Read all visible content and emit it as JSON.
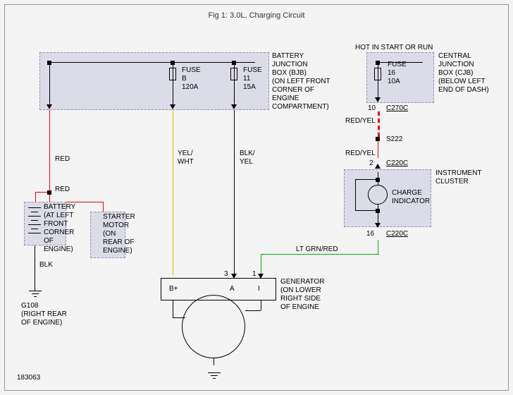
{
  "figure": {
    "title": "Fig 1: 3.0L, Charging Circuit",
    "ref_num": "183063"
  },
  "bjb": {
    "name": "BATTERY\nJUNCTION\nBOX (BJB)\n(ON LEFT FRONT\nCORNER OF\nENGINE\nCOMPARTMENT)",
    "fuse_b": {
      "label": "FUSE\nB\n120A"
    },
    "fuse_11": {
      "label": "FUSE\n11\n15A"
    }
  },
  "cjb": {
    "top_label": "HOT IN START OR RUN",
    "name": "CENTRAL\nJUNCTION\nBOX (CJB)\n(BELOW LEFT\nEND OF DASH)",
    "fuse_16": {
      "label": "FUSE\n16\n10A"
    },
    "pin10": "10",
    "c270c": "C270C"
  },
  "battery": {
    "name": "BATTERY\n(AT LEFT\nFRONT\nCORNER\nOF\nENGINE)"
  },
  "starter": {
    "name": "STARTER\nMOTOR\n(ON\nREAR OF\nENGINE)"
  },
  "instrument_cluster": {
    "name": "INSTRUMENT\nCLUSTER",
    "indicator": "CHARGE\nINDICATOR",
    "pin2": "2",
    "pin16": "16",
    "c220c_top": "C220C",
    "c220c_bot": "C220C"
  },
  "generator": {
    "name": "GENERATOR\n(ON LOWER\nRIGHT SIDE\nOF ENGINE",
    "b_plus": "B+",
    "a": "A",
    "i": "I",
    "pin3": "3",
    "pin1": "1"
  },
  "wires": {
    "red": "RED",
    "red2": "RED",
    "yel_wht": "YEL/\nWHT",
    "blk_yel": "BLK/\nYEL",
    "blk": "BLK",
    "red_yel_top": "RED/YEL",
    "red_yel_mid": "RED/YEL",
    "lt_grn_red": "LT GRN/RED"
  },
  "splice": {
    "s222": "S222"
  },
  "ground": {
    "g108": "G108\n(RIGHT REAR\nOF ENGINE)"
  }
}
